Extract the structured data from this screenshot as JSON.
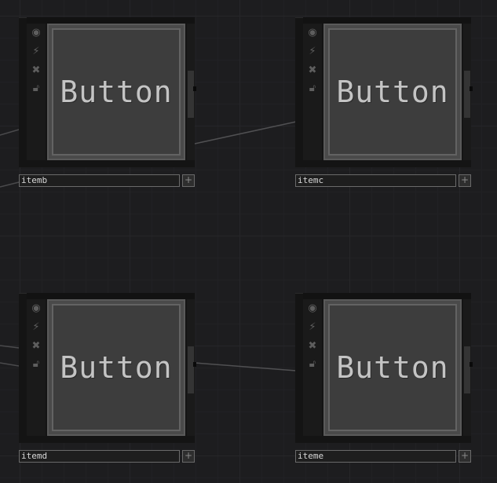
{
  "canvas": {
    "nodes": [
      {
        "name": "itemb",
        "label": "Button",
        "add_symbol": "+"
      },
      {
        "name": "itemc",
        "label": "Button",
        "add_symbol": "+"
      },
      {
        "name": "itemd",
        "label": "Button",
        "add_symbol": "+"
      },
      {
        "name": "iteme",
        "label": "Button",
        "add_symbol": "+"
      }
    ]
  },
  "icons": {
    "viewer_toggle": "target-icon",
    "cook": "lightning-icon",
    "bypass": "x-icon",
    "lock": "lock-icon"
  },
  "colors": {
    "background": "#1d1d1f",
    "node_frame": "#141414",
    "viewer_fill": "#3d3d3d",
    "label_text": "#c4c4c4",
    "wire": "#5a5a5a"
  }
}
